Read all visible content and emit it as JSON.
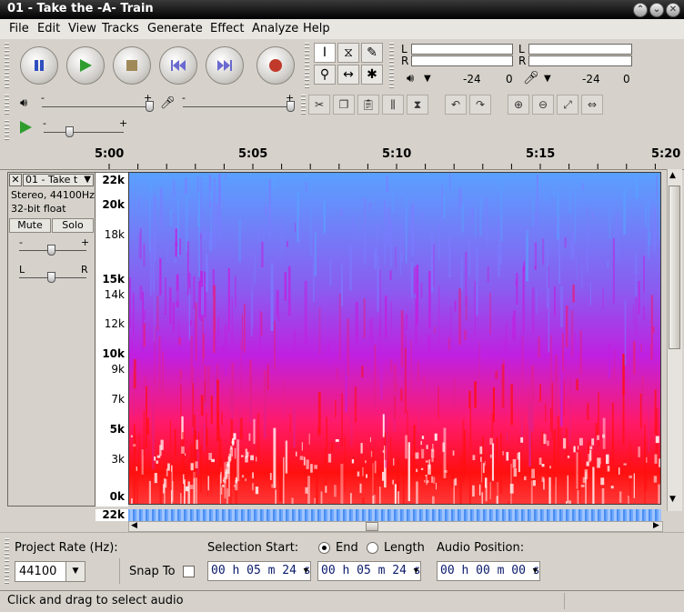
{
  "window": {
    "title": "01 - Take the -A- Train",
    "controls": [
      "⌃",
      "⌄",
      "✕"
    ]
  },
  "menu": [
    "File",
    "Edit",
    "View",
    "Tracks",
    "Generate",
    "Effect",
    "Analyze",
    "Help"
  ],
  "transport": {
    "buttons": [
      "pause-icon",
      "play-icon",
      "stop-icon",
      "skip-start-icon",
      "skip-end-icon",
      "record-icon"
    ]
  },
  "tools": {
    "items": [
      "I",
      "⧖",
      "✎",
      "⚲",
      "↔",
      "✱"
    ]
  },
  "meters": {
    "play_channels": [
      "L",
      "R"
    ],
    "record_channels": [
      "L",
      "R"
    ],
    "play_scale": [
      "-24",
      "0"
    ],
    "record_scale": [
      "-24",
      "0"
    ]
  },
  "mixer": {
    "minus": "-",
    "plus": "+"
  },
  "playat": {
    "minus": "-",
    "plus": "+"
  },
  "ruler": {
    "labels": [
      "5:00",
      "5:05",
      "5:10",
      "5:15",
      "5:20"
    ]
  },
  "track": {
    "name": "01 - Take t",
    "format": "Stereo, 44100Hz",
    "bitdepth": "32-bit float",
    "mute": "Mute",
    "solo": "Solo",
    "gain_minus": "-",
    "gain_plus": "+",
    "pan_left": "L",
    "pan_right": "R"
  },
  "freq_axis": [
    {
      "label": "22k",
      "bold": true
    },
    {
      "label": "20k",
      "bold": true
    },
    {
      "label": "18k",
      "bold": false
    },
    {
      "label": "15k",
      "bold": true
    },
    {
      "label": "14k",
      "bold": false
    },
    {
      "label": "12k",
      "bold": false
    },
    {
      "label": "10k",
      "bold": true
    },
    {
      "label": "9k",
      "bold": false
    },
    {
      "label": "7k",
      "bold": false
    },
    {
      "label": "5k",
      "bold": true
    },
    {
      "label": "3k",
      "bold": false
    },
    {
      "label": "0k",
      "bold": true
    }
  ],
  "second_channel_label": "22k",
  "selection": {
    "project_rate_label": "Project Rate (Hz):",
    "project_rate_value": "44100",
    "snap_to_label": "Snap To",
    "selection_start_label": "Selection Start:",
    "end_label": "End",
    "length_label": "Length",
    "audio_position_label": "Audio Position:",
    "start_time": "00 h 05 m 24 s",
    "end_time": "00 h 05 m 24 s",
    "audio_position": "00 h 00 m 00 s",
    "end_selected": true
  },
  "status": "Click and drag to select audio",
  "colors": {
    "accent_play": "#2e9d2e",
    "pause": "#2f4fbf",
    "record": "#c0392b",
    "spec_low": "#ff1010",
    "spec_mid": "#c020e0",
    "spec_high": "#5aa0ff"
  }
}
